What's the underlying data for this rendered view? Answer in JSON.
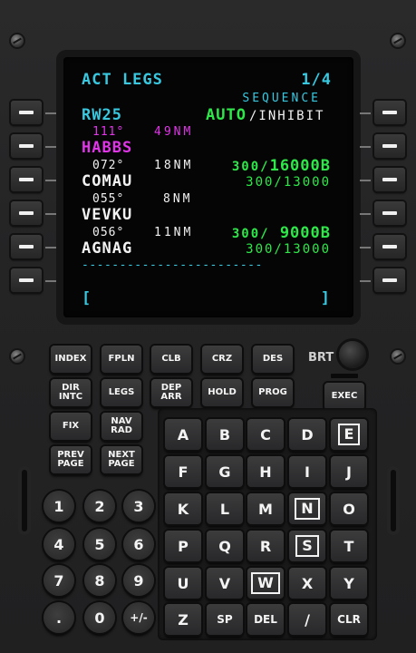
{
  "display": {
    "title": "ACT LEGS",
    "page": "1/4",
    "sequence_label": "SEQUENCE",
    "runway": "RW25",
    "sequence_auto": "AUTO",
    "sequence_inhibit": "/INHIBIT",
    "legs": [
      {
        "course": "111°",
        "distance": "49NM",
        "waypoint": "HABBS",
        "constraint": "300/16000B",
        "active": true
      },
      {
        "course": "072°",
        "distance": "18NM",
        "waypoint": "COMAU",
        "constraint": "300/13000",
        "active": false
      },
      {
        "course": "055°",
        "distance": "8NM",
        "waypoint": "VEVKU",
        "constraint": "300/ 9000B",
        "active": false
      },
      {
        "course": "056°",
        "distance": "11NM",
        "waypoint": "AGNAG",
        "constraint": "300/13000",
        "active": false
      }
    ],
    "separator": "------------------------",
    "scratchpad_open": "[",
    "scratchpad_close": "]"
  },
  "function_keys": {
    "index": "INDEX",
    "fpln": "FPLN",
    "clb": "CLB",
    "crz": "CRZ",
    "des": "DES",
    "dir_intc": "DIR\nINTC",
    "legs": "LEGS",
    "dep_arr": "DEP\nARR",
    "hold": "HOLD",
    "prog": "PROG",
    "fix": "FIX",
    "nav_rad": "NAV\nRAD",
    "prev_page": "PREV\nPAGE",
    "next_page": "NEXT\nPAGE",
    "exec": "EXEC",
    "brt": "BRT"
  },
  "alpha_keys": [
    "A",
    "B",
    "C",
    "D",
    "E",
    "F",
    "G",
    "H",
    "I",
    "J",
    "K",
    "L",
    "M",
    "N",
    "O",
    "P",
    "Q",
    "R",
    "S",
    "T",
    "U",
    "V",
    "W",
    "X",
    "Y",
    "Z",
    "SP",
    "DEL",
    "/",
    "CLR"
  ],
  "numeric_keys": [
    "1",
    "2",
    "3",
    "4",
    "5",
    "6",
    "7",
    "8",
    "9",
    ".",
    "0",
    "+/-"
  ],
  "colors": {
    "cyan": "#38c8e0",
    "green": "#2ee84a",
    "magenta": "#e035e8",
    "white": "#f2f2f2"
  }
}
